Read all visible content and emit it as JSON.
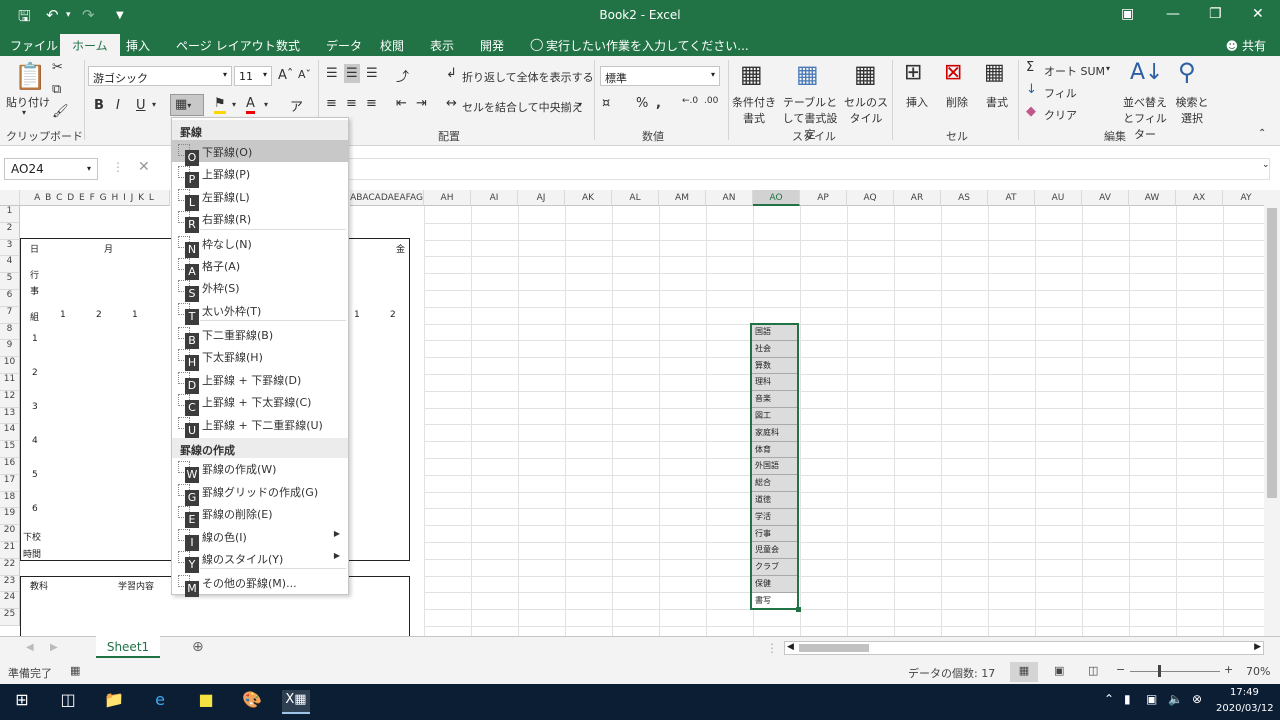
{
  "app": {
    "title": "Book2 - Excel",
    "tabs": [
      "ファイル",
      "ホーム",
      "挿入",
      "ページ レイアウト",
      "数式",
      "データ",
      "校閲",
      "表示",
      "開発"
    ],
    "tell_me": "実行したい作業を入力してください...",
    "share": "共有"
  },
  "ribbon": {
    "paste": "貼り付け",
    "font_name": "游ゴシック",
    "font_size": "11",
    "bold": "B",
    "italic": "I",
    "underline": "U",
    "wrap_text": "折り返して全体を表示する",
    "merge_center": "セルを結合して中央揃え",
    "number_format": "標準",
    "percent": "%",
    "conditional_format": "条件付き書式",
    "format_as_table": "テーブルとして書式設定",
    "cell_styles": "セルのスタイル",
    "insert": "挿入",
    "delete": "削除",
    "format": "書式",
    "autosum": "オート SUM",
    "fill": "フィル",
    "clear": "クリア",
    "sort_filter": "並べ替えとフィルター",
    "find_select": "検索と選択",
    "groups": {
      "clipboard": "クリップボード",
      "alignment": "配置",
      "number": "数値",
      "styles": "スタイル",
      "cells": "セル",
      "editing": "編集"
    }
  },
  "formula_bar": {
    "name_box": "AO24"
  },
  "grid": {
    "narrow_headers": "A B C D E F G H I J K L",
    "left_trail": "ABACADAEAFAG",
    "columns": [
      "AH",
      "AI",
      "AJ",
      "AK",
      "AL",
      "AM",
      "AN",
      "AO",
      "AP",
      "AQ",
      "AR",
      "AS",
      "AT",
      "AU",
      "AV",
      "AW",
      "AX",
      "AY"
    ],
    "selected_column": "AO",
    "rows": [
      "1",
      "2",
      "3",
      "4",
      "5",
      "6",
      "7",
      "8",
      "9",
      "10",
      "11",
      "12",
      "13",
      "14",
      "15",
      "16",
      "17",
      "18",
      "19",
      "20",
      "21",
      "22",
      "23",
      "24",
      "25"
    ],
    "sheet_text": {
      "day": "日",
      "month": "月",
      "gyo": "行",
      "ji": "事",
      "kumi": "組",
      "kin": "金",
      "h1": "1",
      "h2": "2",
      "h3": "1",
      "h4": "1",
      "h5": "2",
      "p1": "1",
      "p2": "2",
      "p3": "3",
      "p4": "4",
      "p5": "5",
      "p6": "6",
      "gekou1": "下校",
      "gekou2": "時間",
      "subject": "教科",
      "content": "学習内容"
    },
    "list": [
      "国語",
      "社会",
      "算数",
      "理科",
      "音楽",
      "図工",
      "家庭科",
      "体育",
      "外国語",
      "総合",
      "道徳",
      "学活",
      "行事",
      "児童会",
      "クラブ",
      "保健",
      "書写"
    ]
  },
  "border_menu": {
    "header1": "罫線",
    "header2": "罫線の作成",
    "items": [
      {
        "label": "下罫線(O)",
        "key": "O"
      },
      {
        "label": "上罫線(P)",
        "key": "P"
      },
      {
        "label": "左罫線(L)",
        "key": "L"
      },
      {
        "label": "右罫線(R)",
        "key": "R"
      },
      {
        "label": "枠なし(N)",
        "key": "N"
      },
      {
        "label": "格子(A)",
        "key": "A"
      },
      {
        "label": "外枠(S)",
        "key": "S"
      },
      {
        "label": "太い外枠(T)",
        "key": "T"
      },
      {
        "label": "下二重罫線(B)",
        "key": "B"
      },
      {
        "label": "下太罫線(H)",
        "key": "H"
      },
      {
        "label": "上罫線 + 下罫線(D)",
        "key": "D"
      },
      {
        "label": "上罫線 + 下太罫線(C)",
        "key": "C"
      },
      {
        "label": "上罫線 + 下二重罫線(U)",
        "key": "U"
      },
      {
        "label": "罫線の作成(W)",
        "key": "W"
      },
      {
        "label": "罫線グリッドの作成(G)",
        "key": "G"
      },
      {
        "label": "罫線の削除(E)",
        "key": "E"
      },
      {
        "label": "線の色(I)",
        "key": "I"
      },
      {
        "label": "線のスタイル(Y)",
        "key": "Y"
      },
      {
        "label": "その他の罫線(M)...",
        "key": "M"
      }
    ]
  },
  "sheets": {
    "active": "Sheet1"
  },
  "status": {
    "ready": "準備完了",
    "count": "データの個数: 17",
    "zoom": "70%"
  },
  "taskbar": {
    "time": "17:49",
    "date": "2020/03/12"
  }
}
